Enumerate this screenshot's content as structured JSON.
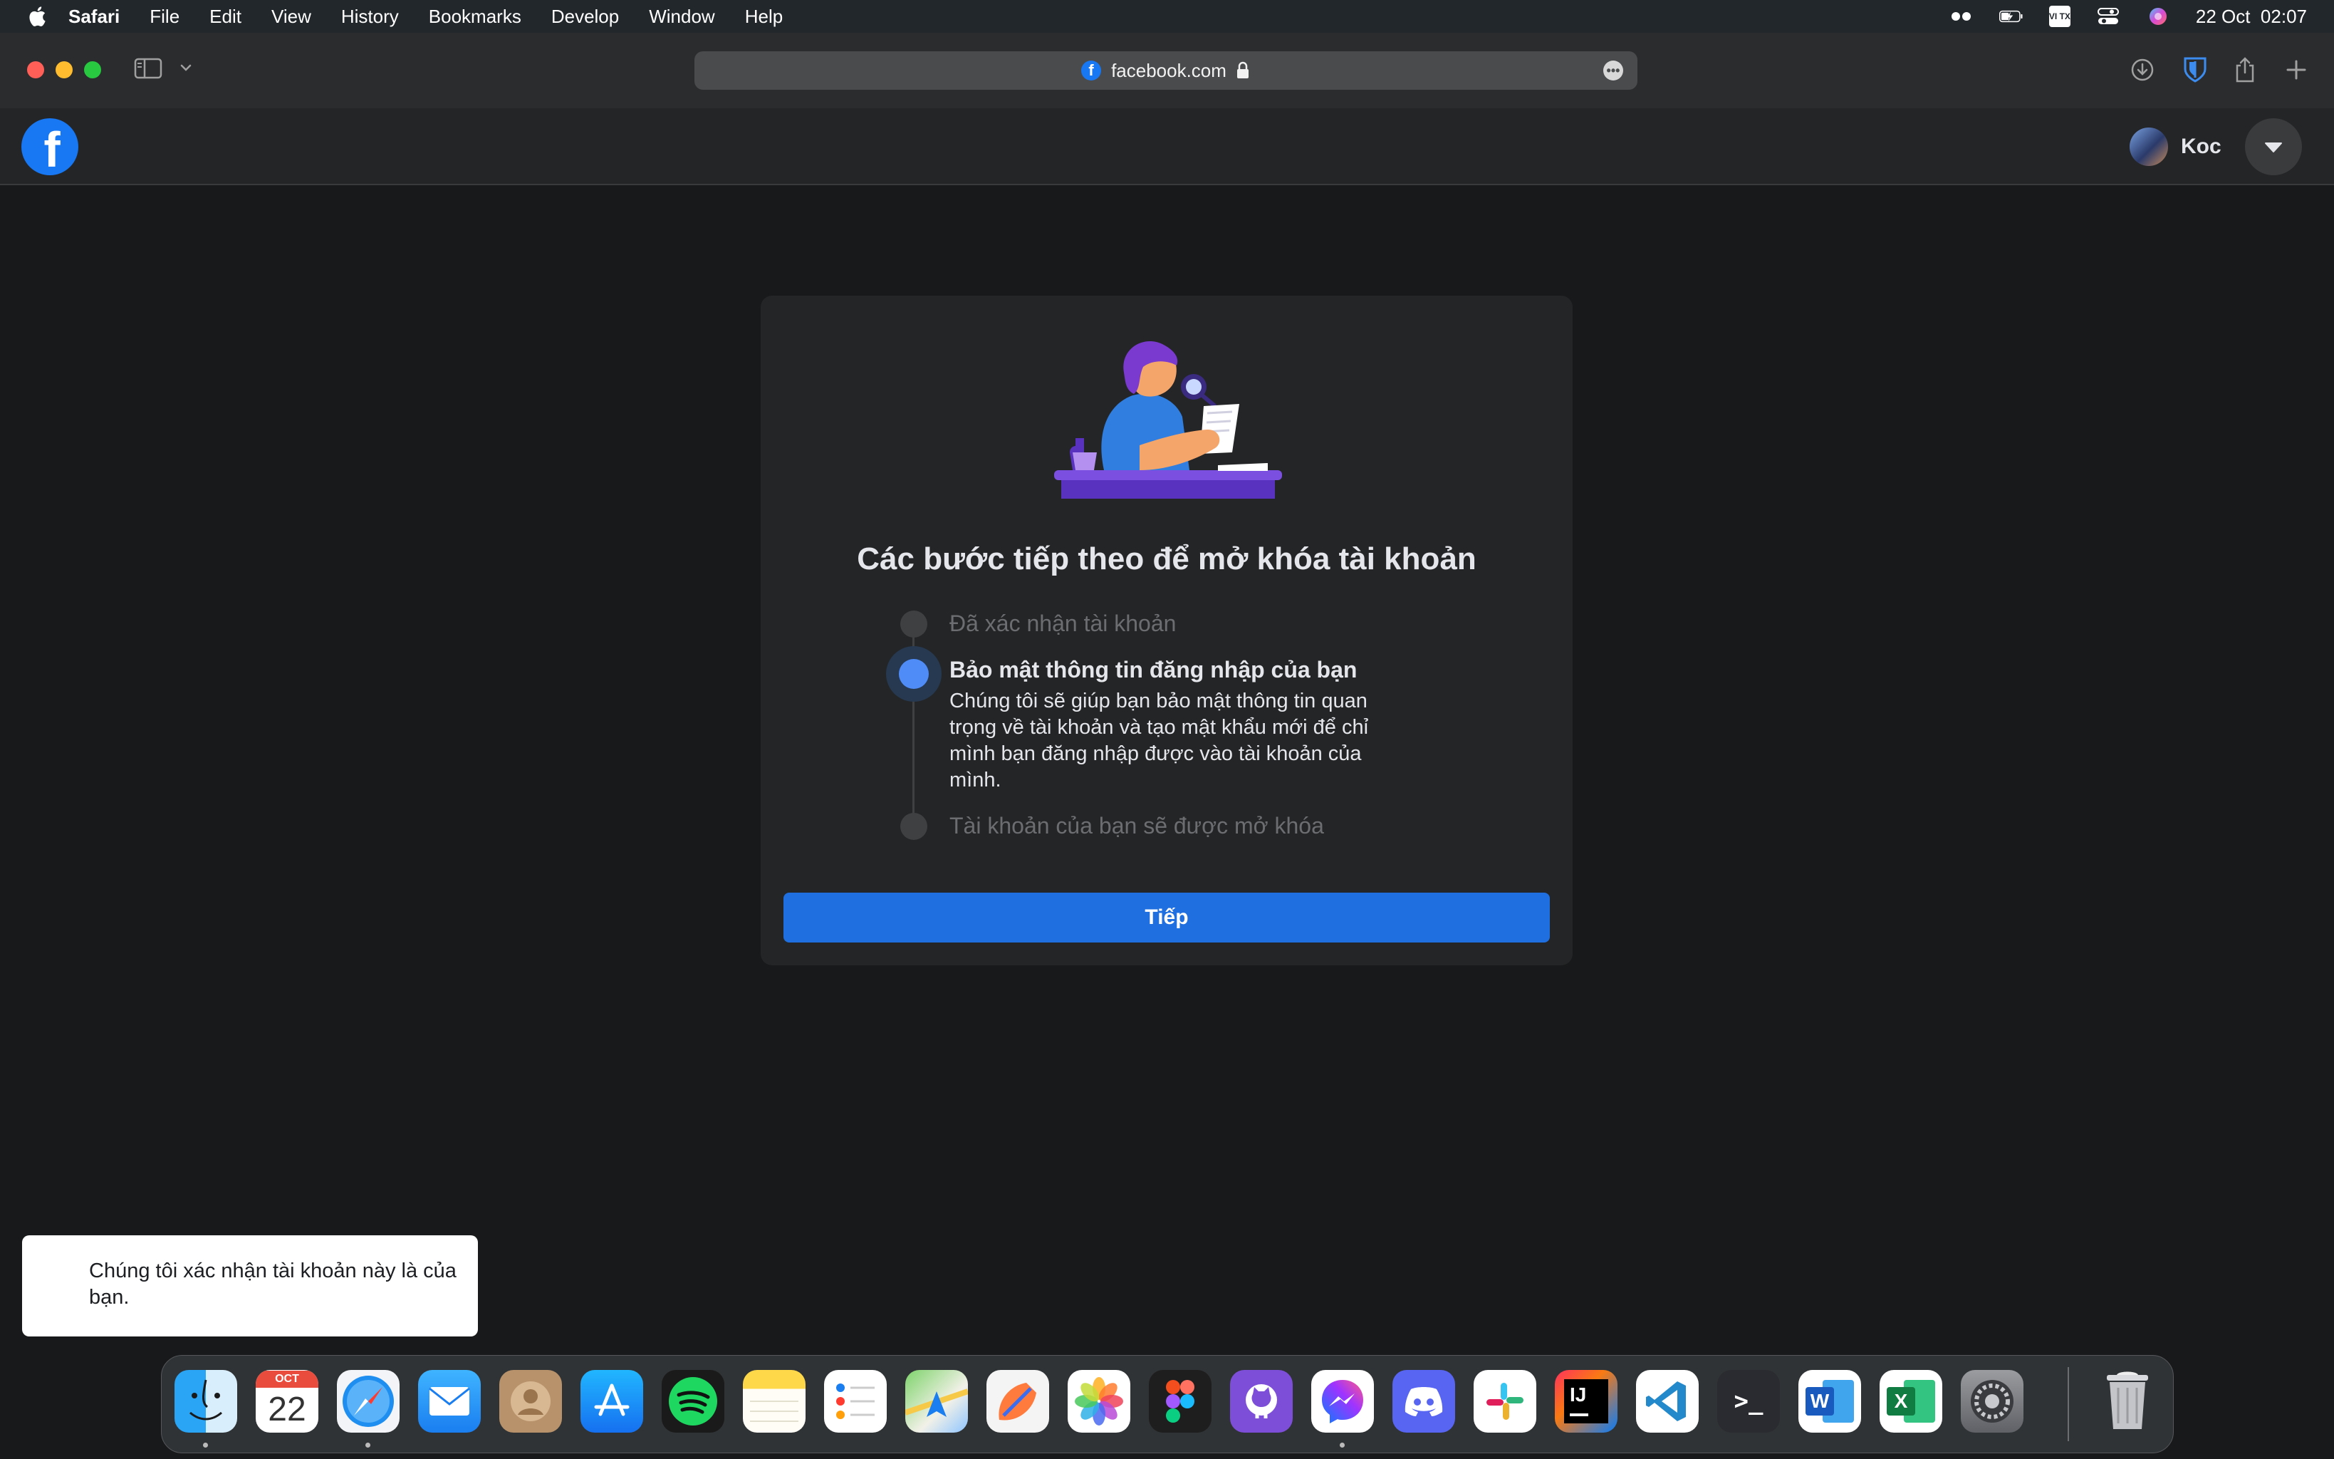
{
  "menubar": {
    "app_name": "Safari",
    "items": [
      "File",
      "Edit",
      "View",
      "History",
      "Bookmarks",
      "Develop",
      "Window",
      "Help"
    ],
    "input_source": "VI TX",
    "datetime": "22 Oct  02:07"
  },
  "browser": {
    "url": "facebook.com",
    "favicon_letter": "f"
  },
  "facebook": {
    "logo_letter": "f",
    "profile_name": "Koc"
  },
  "card": {
    "title": "Các bước tiếp theo để mở khóa tài khoản",
    "steps": [
      {
        "label": "Đã xác nhận tài khoản",
        "state": "done"
      },
      {
        "label": "Bảo mật thông tin đăng nhập của bạn",
        "state": "current",
        "description": "Chúng tôi sẽ giúp bạn bảo mật thông tin quan trọng về tài khoản và tạo mật khẩu mới để chỉ mình bạn đăng nhập được vào tài khoản của mình."
      },
      {
        "label": "Tài khoản của bạn sẽ được mở khóa",
        "state": "pending"
      }
    ],
    "button_label": "Tiếp"
  },
  "toast": {
    "message": "Chúng tôi xác nhận tài khoản này là của bạn."
  },
  "dock": {
    "calendar_month": "OCT",
    "calendar_day": "22",
    "apps": [
      "finder",
      "calendar",
      "safari",
      "mail",
      "contacts",
      "app-store",
      "spotify",
      "notes",
      "reminders",
      "maps",
      "pixelmator",
      "photos",
      "figma",
      "github-desktop",
      "messenger",
      "discord",
      "slack",
      "intellij-idea",
      "vscode",
      "terminal",
      "word",
      "excel",
      "system-settings",
      "trash"
    ],
    "intellij_label": "IJ",
    "terminal_label": ">_",
    "word_letter": "W",
    "excel_letter": "X"
  },
  "colors": {
    "fb_blue": "#1877f2",
    "button_blue": "#1f6fe0",
    "current_step": "#4f8cf7",
    "card_bg": "#242526",
    "page_bg": "#18191a"
  }
}
